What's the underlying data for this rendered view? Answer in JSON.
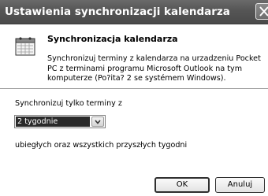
{
  "window": {
    "title": "Ustawienia synchronizacji kalendarza",
    "close_icon": "close-icon"
  },
  "header": {
    "icon": "calendar-icon",
    "heading": "Synchronizacja kalendarza",
    "description": "Synchronizuj terminy z kalendarza na urzadzeniu Pocket PC z terminami programu Microsoft Outlook na tym komputerze (Po?ita? 2 se systémem Windows)."
  },
  "form": {
    "sync_label": "Synchronizuj tylko terminy z",
    "period_select": {
      "value": "2 tygodnie"
    },
    "range_label": "ubiegłych oraz wszystkich przyszłych tygodni"
  },
  "buttons": {
    "ok_label": "OK",
    "cancel_label": "Anuluj"
  }
}
